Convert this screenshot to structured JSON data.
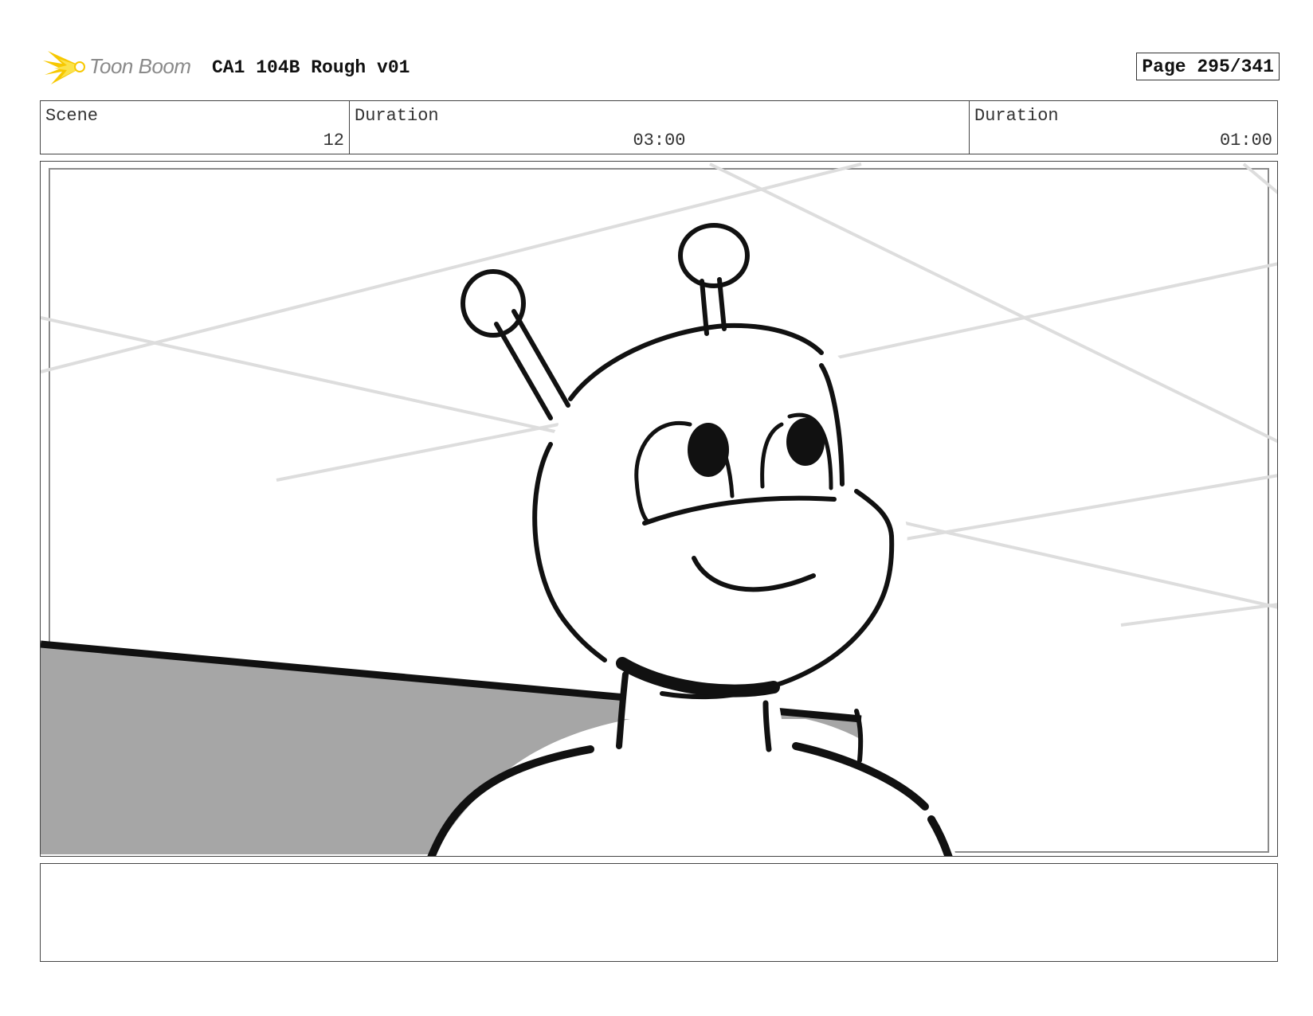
{
  "header": {
    "logo_text": "Toon Boom",
    "title": "CA1 104B Rough v01",
    "page": "Page 295/341"
  },
  "info": {
    "scene_label": "Scene",
    "scene_value": "12",
    "duration1_label": "Duration",
    "duration1_value": "03:00",
    "duration2_label": "Duration",
    "duration2_value": "01:00"
  },
  "colors": {
    "logo_yellow": "#f7c800",
    "floor_gray": "#a6a6a6",
    "ink": "#111111",
    "guide_lines": "#dddddd"
  }
}
